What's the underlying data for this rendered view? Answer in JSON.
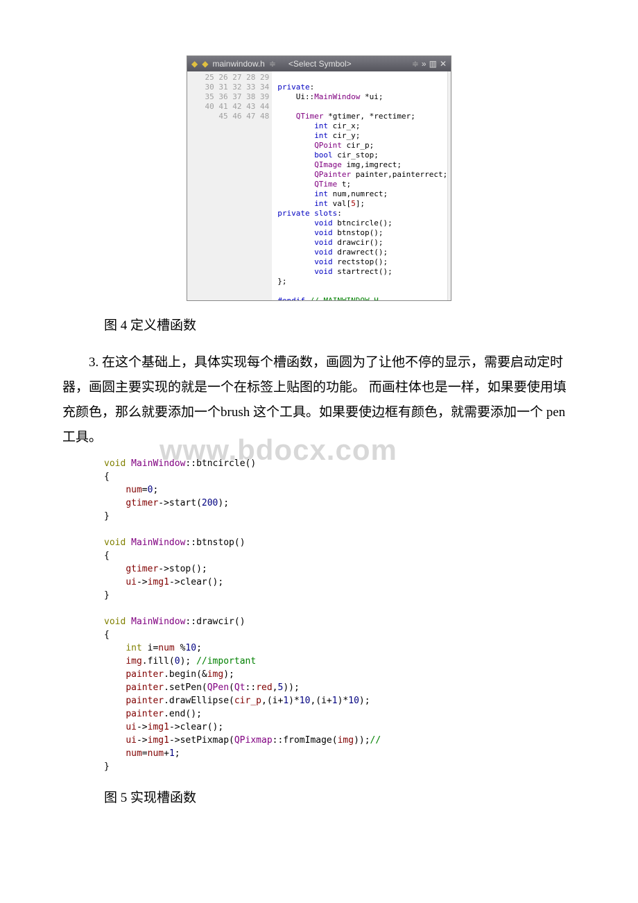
{
  "editor": {
    "file": "mainwindow.h",
    "symbol": "<Select Symbol>",
    "lines": [
      {
        "n": 25,
        "t": ""
      },
      {
        "n": 26,
        "t": "<span class='k-blue'>private</span>:"
      },
      {
        "n": 27,
        "t": "    Ui::<span class='k-purple'>MainWindow</span> *ui;"
      },
      {
        "n": 28,
        "t": ""
      },
      {
        "n": 29,
        "t": "    <span class='k-purple'>QTimer</span> *gtimer, *rectimer;"
      },
      {
        "n": 30,
        "t": "        <span class='k-blue'>int</span> cir_x;"
      },
      {
        "n": 31,
        "t": "        <span class='k-blue'>int</span> cir_y;"
      },
      {
        "n": 32,
        "t": "        <span class='k-purple'>QPoint</span> cir_p;"
      },
      {
        "n": 33,
        "t": "        <span class='k-blue'>bool</span> cir_stop;"
      },
      {
        "n": 34,
        "t": "        <span class='k-purple'>QImage</span> img,imgrect;"
      },
      {
        "n": 35,
        "t": "        <span class='k-purple'>QPainter</span> painter,painterrect;"
      },
      {
        "n": 36,
        "t": "        <span class='k-purple'>QTime</span> t;"
      },
      {
        "n": 37,
        "t": "        <span class='k-blue'>int</span> num,numrect;"
      },
      {
        "n": 38,
        "t": "        <span class='k-blue'>int</span> val[<span class='k-red'>5</span>];"
      },
      {
        "n": 39,
        "t": "<span class='k-blue'>private slots</span>:"
      },
      {
        "n": 40,
        "t": "        <span class='k-blue'>void</span> btncircle();"
      },
      {
        "n": 41,
        "t": "        <span class='k-blue'>void</span> btnstop();"
      },
      {
        "n": 42,
        "t": "        <span class='k-blue'>void</span> drawcir();"
      },
      {
        "n": 43,
        "t": "        <span class='k-blue'>void</span> drawrect();"
      },
      {
        "n": 44,
        "t": "        <span class='k-blue'>void</span> rectstop();"
      },
      {
        "n": 45,
        "t": "        <span class='k-blue'>void</span> startrect();"
      },
      {
        "n": 46,
        "t": "};"
      },
      {
        "n": 47,
        "t": ""
      },
      {
        "n": 48,
        "t": "<span class='k-blue'>#endif</span> <span class='k-green'>// MAINWINDOW_H</span>"
      }
    ]
  },
  "caption1": "图 4 定义槽函数",
  "para1": "3. 在这个基础上，具体实现每个槽函数，画圆为了让他不停的显示，需要启动定时器，画圆主要实现的就是一个在标签上贴图的功能。 而画柱体也是一样，如果要使用填充颜色，那么就要添加一个brush 这个工具。如果要使边框有颜色，就需要添加一个 pen 工具。",
  "watermark": "www.bdocx.com",
  "code2_lines": [
    "<span class='c-olive'>void</span> <span class='c-purple'>MainWindow</span>::btncircle()",
    "{",
    "    <span class='c-red'>num</span>=<span class='c-blue'>0</span>;",
    "    <span class='c-red'>gtimer</span>->start(<span class='c-blue'>200</span>);",
    "}",
    "",
    "<span class='c-olive'>void</span> <span class='c-purple'>MainWindow</span>::btnstop()",
    "{",
    "    <span class='c-red'>gtimer</span>->stop();",
    "    <span class='c-red'>ui</span>-><span class='c-red'>img1</span>->clear();",
    "}",
    "",
    "<span class='c-olive'>void</span> <span class='c-purple'>MainWindow</span>::drawcir()",
    "{",
    "    <span class='c-olive'>int</span> i=<span class='c-red'>num</span> %<span class='c-blue'>10</span>;",
    "    <span class='c-red'>img</span>.fill(<span class='c-blue'>0</span>); <span class='c-green'>//important</span>",
    "    <span class='c-red'>painter</span>.begin(&<span class='c-red'>img</span>);",
    "    <span class='c-red'>painter</span>.setPen(<span class='c-purple'>QPen</span>(<span class='c-purple'>Qt</span>::<span class='c-red'>red</span>,<span class='c-blue'>5</span>));",
    "    <span class='c-red'>painter</span>.drawEllipse(<span class='c-red'>cir_p</span>,(i+<span class='c-blue'>1</span>)*<span class='c-blue'>10</span>,(i+<span class='c-blue'>1</span>)*<span class='c-blue'>10</span>);",
    "    <span class='c-red'>painter</span>.end();",
    "    <span class='c-red'>ui</span>-><span class='c-red'>img1</span>->clear();",
    "    <span class='c-red'>ui</span>-><span class='c-red'>img1</span>->setPixmap(<span class='c-purple'>QPixmap</span>::fromImage(<span class='c-red'>img</span>));<span class='c-green'>//</span>",
    "    <span class='c-red'>num</span>=<span class='c-red'>num</span>+<span class='c-blue'>1</span>;",
    "}"
  ],
  "caption2": "图 5 实现槽函数"
}
